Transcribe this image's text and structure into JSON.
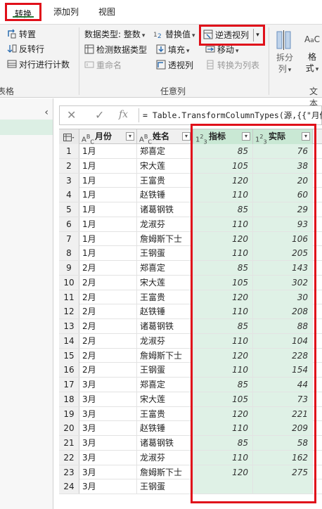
{
  "tabs": [
    "转换",
    "添加列",
    "视图"
  ],
  "ribbon": {
    "table_group": {
      "transpose": "转置",
      "reverse_rows": "反转行",
      "count_rows": "对行进行计数",
      "name": "表格"
    },
    "any_column_group": {
      "data_type": "数据类型: 整数",
      "detect_type": "检测数据类型",
      "rename": "重命名",
      "replace_values": "替换值",
      "fill": "填充",
      "pivot": "透视列",
      "unpivot": "逆透视列",
      "move": "移动",
      "convert_to_list": "转换为列表",
      "name": "任意列"
    },
    "text_group": {
      "split": "拆分\n列",
      "split_line1": "拆分",
      "split_line2": "列",
      "format_line1": "格",
      "format_line2": "式",
      "name": "文本"
    }
  },
  "formula_bar": {
    "fx": "fx",
    "text": "= Table.TransformColumnTypes(源,{{\"月份"
  },
  "columns": [
    {
      "name": "月份",
      "type": "ABC"
    },
    {
      "name": "姓名",
      "type": "ABC"
    },
    {
      "name": "指标",
      "type": "123"
    },
    {
      "name": "实际",
      "type": "123"
    }
  ],
  "rows": [
    {
      "i": "1",
      "month": "1月",
      "name": "郑喜定",
      "target": "85",
      "actual": "76"
    },
    {
      "i": "2",
      "month": "1月",
      "name": "宋大莲",
      "target": "105",
      "actual": "38"
    },
    {
      "i": "3",
      "month": "1月",
      "name": "王富贵",
      "target": "120",
      "actual": "20"
    },
    {
      "i": "4",
      "month": "1月",
      "name": "赵铁锤",
      "target": "110",
      "actual": "60"
    },
    {
      "i": "5",
      "month": "1月",
      "name": "诸葛钢铁",
      "target": "85",
      "actual": "29"
    },
    {
      "i": "6",
      "month": "1月",
      "name": "龙淑芬",
      "target": "110",
      "actual": "93"
    },
    {
      "i": "7",
      "month": "1月",
      "name": "詹姆斯下士",
      "target": "120",
      "actual": "106"
    },
    {
      "i": "8",
      "month": "1月",
      "name": "王钢蛋",
      "target": "110",
      "actual": "205"
    },
    {
      "i": "9",
      "month": "2月",
      "name": "郑喜定",
      "target": "85",
      "actual": "143"
    },
    {
      "i": "10",
      "month": "2月",
      "name": "宋大莲",
      "target": "105",
      "actual": "302"
    },
    {
      "i": "11",
      "month": "2月",
      "name": "王富贵",
      "target": "120",
      "actual": "30"
    },
    {
      "i": "12",
      "month": "2月",
      "name": "赵铁锤",
      "target": "110",
      "actual": "208"
    },
    {
      "i": "13",
      "month": "2月",
      "name": "诸葛钢铁",
      "target": "85",
      "actual": "88"
    },
    {
      "i": "14",
      "month": "2月",
      "name": "龙淑芬",
      "target": "110",
      "actual": "104"
    },
    {
      "i": "15",
      "month": "2月",
      "name": "詹姆斯下士",
      "target": "120",
      "actual": "228"
    },
    {
      "i": "16",
      "month": "2月",
      "name": "王钢蛋",
      "target": "110",
      "actual": "154"
    },
    {
      "i": "17",
      "month": "3月",
      "name": "郑喜定",
      "target": "85",
      "actual": "44"
    },
    {
      "i": "18",
      "month": "3月",
      "name": "宋大莲",
      "target": "105",
      "actual": "73"
    },
    {
      "i": "19",
      "month": "3月",
      "name": "王富贵",
      "target": "120",
      "actual": "221"
    },
    {
      "i": "20",
      "month": "3月",
      "name": "赵铁锤",
      "target": "110",
      "actual": "209"
    },
    {
      "i": "21",
      "month": "3月",
      "name": "诸葛钢铁",
      "target": "85",
      "actual": "58"
    },
    {
      "i": "22",
      "month": "3月",
      "name": "龙淑芬",
      "target": "110",
      "actual": "162"
    },
    {
      "i": "23",
      "month": "3月",
      "name": "詹姆斯下士",
      "target": "120",
      "actual": "275"
    },
    {
      "i": "24",
      "month": "3月",
      "name": "王钢蛋",
      "target": "",
      "actual": ""
    }
  ],
  "colors": {
    "highlight": "#e0101a",
    "selected_column_bg": "#dff1e6",
    "active_tab_underline": "#2c7a3a"
  }
}
